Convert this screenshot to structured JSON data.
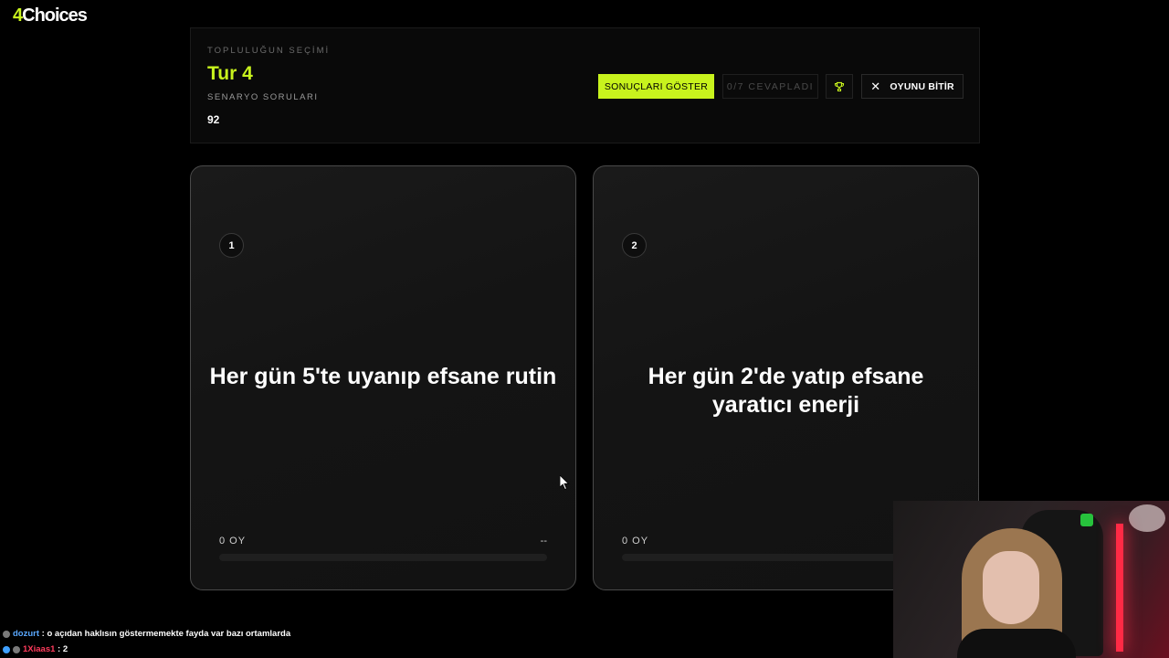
{
  "logo": {
    "prefix": "4",
    "suffix": "Choices"
  },
  "header": {
    "eyebrow": "TOPLULUĞUN SEÇİMİ",
    "round_title": "Tur 4",
    "subtitle": "SENARYO SORULARI",
    "count": "92",
    "results_button": "SONUÇLARI GÖSTER",
    "answered_status": "0/7 CEVAPLADI",
    "trophy_icon": "trophy-icon",
    "end_button": "OYUNU BİTİR",
    "end_icon": "close-icon"
  },
  "options": [
    {
      "number": "1",
      "text": "Her gün 5'te uyanıp efsane rutin",
      "votes": "0 OY",
      "percent": "--",
      "fill": 0
    },
    {
      "number": "2",
      "text": "Her gün 2'de yatıp efsane yaratıcı enerji",
      "votes": "0 OY",
      "percent": "",
      "fill": 0
    }
  ],
  "chat": [
    {
      "user": "dozurt",
      "message": ": o açıdan haklısın göstermemekte fayda var bazı ortamlarda"
    },
    {
      "user": "1Xiaas1",
      "message": ": 2"
    }
  ],
  "colors": {
    "accent": "#c8f31d",
    "background": "#000000",
    "card": "#141414"
  }
}
